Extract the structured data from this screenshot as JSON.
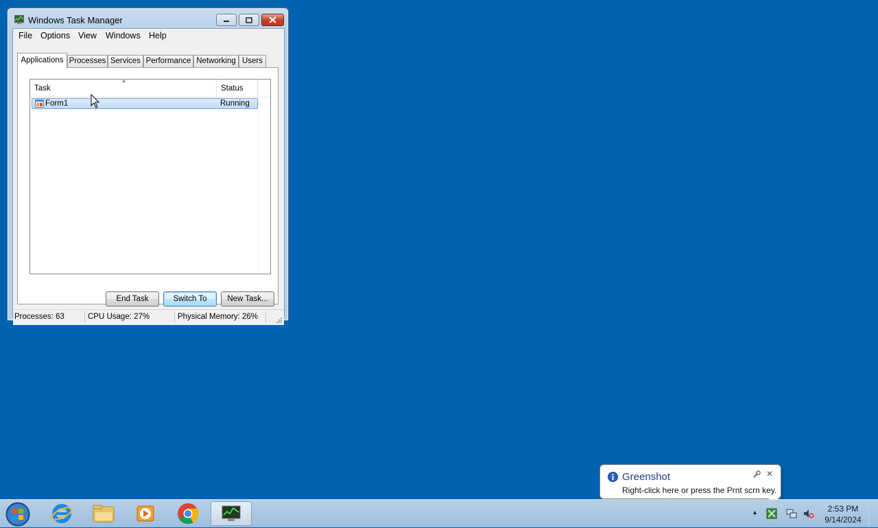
{
  "window": {
    "title": "Windows Task Manager",
    "icon": "task-manager-icon"
  },
  "menu": [
    "File",
    "Options",
    "View",
    "Windows",
    "Help"
  ],
  "tabs": [
    {
      "label": "Applications",
      "active": true
    },
    {
      "label": "Processes"
    },
    {
      "label": "Services"
    },
    {
      "label": "Performance"
    },
    {
      "label": "Networking"
    },
    {
      "label": "Users"
    }
  ],
  "list": {
    "columns": [
      "Task",
      "Status"
    ],
    "rows": [
      {
        "task": "Form1",
        "status": "Running",
        "selected": true
      }
    ]
  },
  "buttons": {
    "end_task": "End Task",
    "switch_to": "Switch To",
    "new_task": "New Task..."
  },
  "status": {
    "processes": "Processes: 63",
    "cpu": "CPU Usage: 27%",
    "memory": "Physical Memory: 26%"
  },
  "balloon": {
    "title": "Greenshot",
    "text": "Right-click here or press the Prnt scrn key."
  },
  "clock": {
    "time": "2:53 PM",
    "date": "9/14/2024"
  },
  "taskbar": {
    "apps": [
      "internet-explorer-icon",
      "file-explorer-icon",
      "media-player-icon",
      "chrome-icon",
      "task-manager-icon"
    ]
  },
  "colors": {
    "desktop": "#0063b1",
    "selection": "#c1dbfc"
  }
}
